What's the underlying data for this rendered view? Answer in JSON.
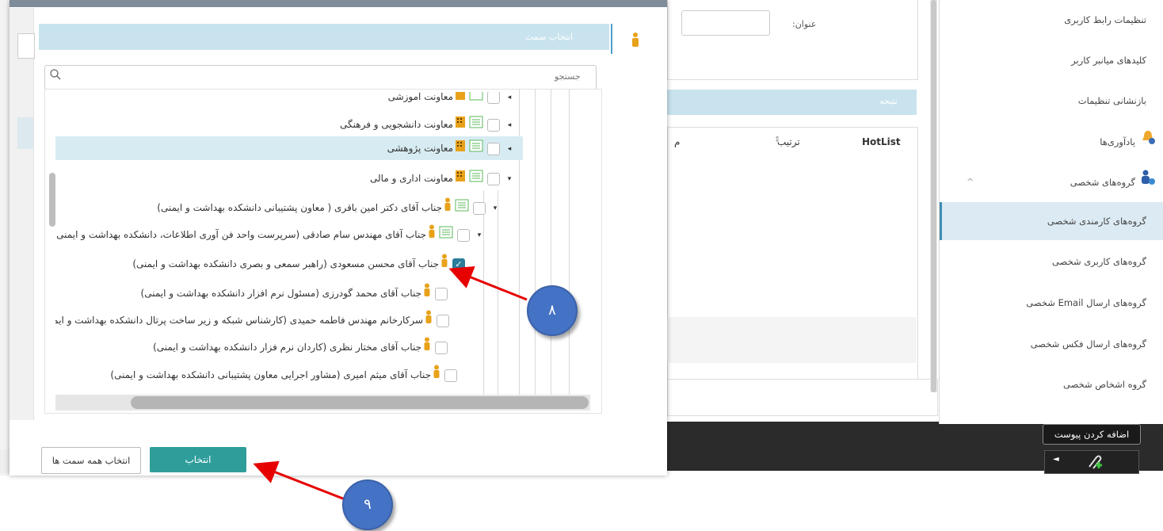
{
  "sidebar": {
    "items": [
      {
        "label": "تنظیمات رابط کاربری"
      },
      {
        "label": "کلیدهای میانبر کاربر"
      },
      {
        "label": "بازنشانی تنظیمات"
      },
      {
        "label": "یادآوری‌ها"
      },
      {
        "label": "گروه‌های شخصی"
      },
      {
        "label": "گروه‌های کارمندی شخصی"
      },
      {
        "label": "گروه‌های کاربری شخصی"
      },
      {
        "label": "گروه‌های ارسال Email شخصی"
      },
      {
        "label": "گروه‌های ارسال فکس شخصی"
      },
      {
        "label": "گروه اشخاص شخصی"
      }
    ]
  },
  "background": {
    "title_label": "عنوان:",
    "result_label": "نتیجه",
    "columns": [
      "HotList",
      "ترتیب",
      "م"
    ]
  },
  "modal": {
    "header_title": "انتخاب سمت",
    "search_placeholder": "جستجو",
    "tree": [
      {
        "label": "معاونت آموزشی"
      },
      {
        "label": "معاونت دانشجویی و فرهنگی"
      },
      {
        "label": "معاونت پژوهشی"
      },
      {
        "label": "معاونت اداری و مالی"
      },
      {
        "label": "جناب آقای دکتر امین باقری ( معاون پشتیبانی دانشکده بهداشت و ایمنی)"
      },
      {
        "label": "جناب آقای مهندس سام صادقی (سرپرست واحد فن آوری اطلاعات، دانشکده بهداشت و ایمنی)"
      },
      {
        "label": "جناب آقای محسن مسعودی (راهبر سمعی و بصری دانشکده بهداشت و ایمنی)"
      },
      {
        "label": "جناب آقای محمد گودرزی (مسئول نرم افزار دانشکده بهداشت و ایمنی)"
      },
      {
        "label": "سرکارخانم مهندس فاطمه حمیدی (کارشناس شبکه و زیر ساخت پرتال دانشکده بهداشت و ایمنی)"
      },
      {
        "label": "جناب آقای مختار نظری (کاردان نرم فزار دانشکده بهداشت و ایمنی)"
      },
      {
        "label": "جناب آقای میثم امیری (مشاور اجرایی معاون پشتیبانی دانشکده بهداشت و ایمنی)"
      }
    ],
    "btn_select": "انتخاب",
    "btn_select_all": "انتخاب همه سمت ها"
  },
  "tooltip": "اضافه کردن پیوست",
  "annotations": {
    "step8": "۸",
    "step9": "۹"
  },
  "colors": {
    "teal": "#2f9e9b",
    "header_blue": "#c8e3ee",
    "bubble": "#4472c4",
    "arrow": "#e60000"
  }
}
